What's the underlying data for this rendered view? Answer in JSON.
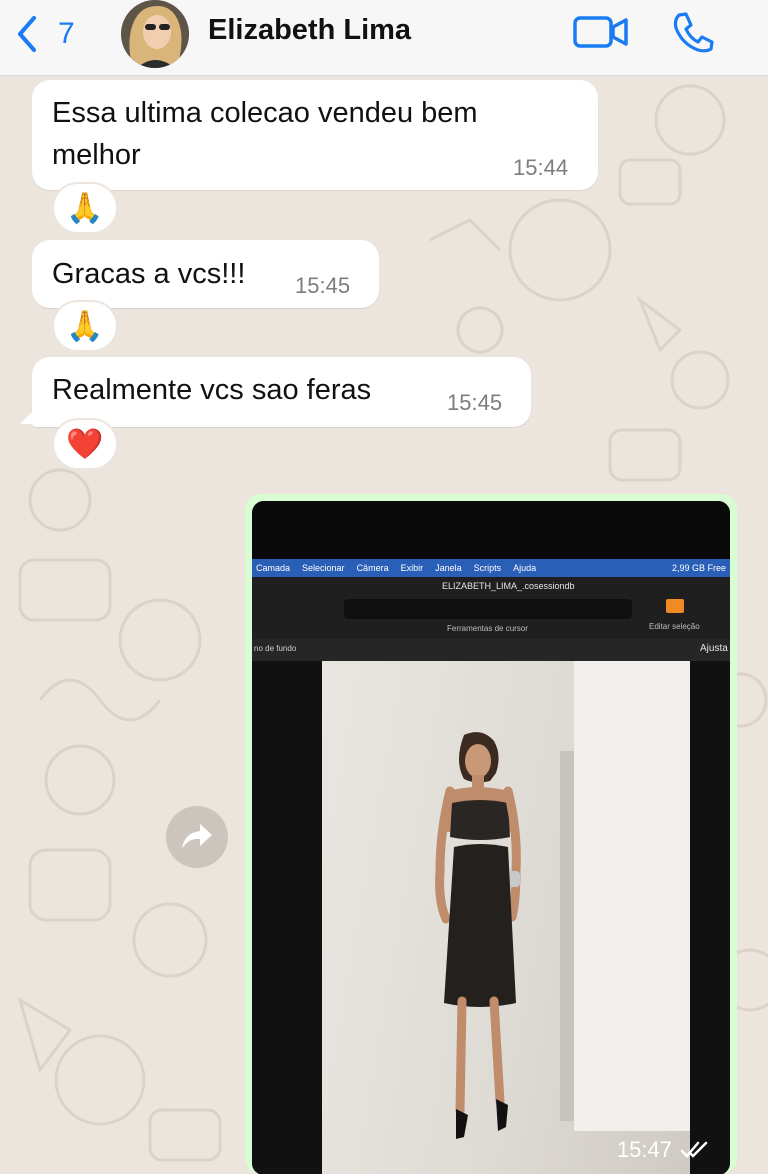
{
  "header": {
    "back_count": "7",
    "contact_name": "Elizabeth Lima"
  },
  "messages": [
    {
      "text": "Essa ultima colecao vendeu bem melhor",
      "line1": "Essa ultima colecao vendeu bem",
      "line2": "melhor",
      "time": "15:44",
      "reaction": "🙏"
    },
    {
      "text": "Gracas a vcs!!!",
      "time": "15:45",
      "reaction": "🙏"
    },
    {
      "text": "Realmente vcs sao feras",
      "time": "15:45",
      "reaction": "❤️"
    }
  ],
  "image_message": {
    "time": "15:47",
    "status": "read",
    "screen": {
      "menu_items": [
        "Camada",
        "Selecionar",
        "Câmera",
        "Exibir",
        "Janela",
        "Scripts",
        "Ajuda"
      ],
      "storage": "2,99 GB Free",
      "filename": "ELIZABETH_LIMA_.cosessiondb",
      "tools_label": "Ferramentas de cursor",
      "edit_label": "Editar seleção",
      "layer_label": "no de fundo",
      "adjust_label": "Ajusta"
    }
  },
  "colors": {
    "accent": "#1a7cf5",
    "outgoing_bubble": "#d9fdd3",
    "incoming_bubble": "#ffffff",
    "chat_background": "#ece5dd"
  }
}
